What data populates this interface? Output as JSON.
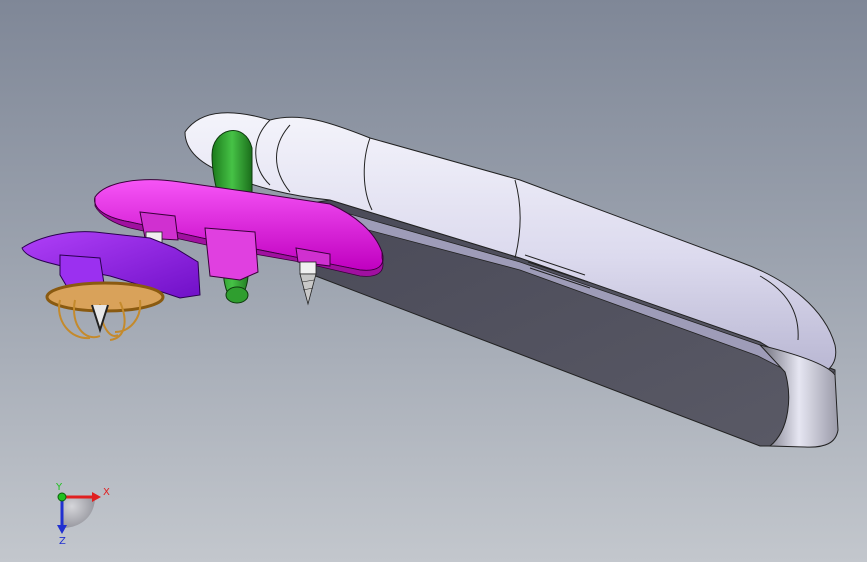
{
  "viewport": {
    "background_top": "#7f8797",
    "background_bottom": "#c3c7cd"
  },
  "model": {
    "parts": [
      {
        "name": "arm-housing",
        "color": "#e4e2f2"
      },
      {
        "name": "mounting-bracket",
        "color": "#ee22ee"
      },
      {
        "name": "pivot-base",
        "color": "#a020f0"
      },
      {
        "name": "wire-clip",
        "color": "#c48a2c"
      },
      {
        "name": "cable-pipe",
        "color": "#2f9e2f"
      }
    ]
  },
  "triad": {
    "x_label": "X",
    "y_label": "Y",
    "z_label": "Z",
    "x_color": "#e02020",
    "y_color": "#20c020",
    "z_color": "#2030d0"
  }
}
